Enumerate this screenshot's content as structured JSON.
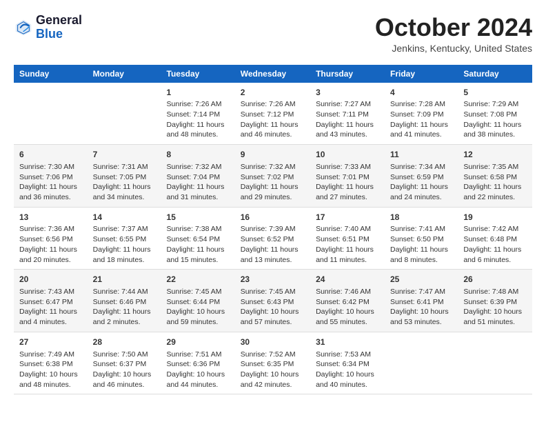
{
  "header": {
    "logo_line1": "General",
    "logo_line2": "Blue",
    "month": "October 2024",
    "location": "Jenkins, Kentucky, United States"
  },
  "days_of_week": [
    "Sunday",
    "Monday",
    "Tuesday",
    "Wednesday",
    "Thursday",
    "Friday",
    "Saturday"
  ],
  "weeks": [
    [
      {
        "day": "",
        "info": ""
      },
      {
        "day": "",
        "info": ""
      },
      {
        "day": "1",
        "info": "Sunrise: 7:26 AM\nSunset: 7:14 PM\nDaylight: 11 hours and 48 minutes."
      },
      {
        "day": "2",
        "info": "Sunrise: 7:26 AM\nSunset: 7:12 PM\nDaylight: 11 hours and 46 minutes."
      },
      {
        "day": "3",
        "info": "Sunrise: 7:27 AM\nSunset: 7:11 PM\nDaylight: 11 hours and 43 minutes."
      },
      {
        "day": "4",
        "info": "Sunrise: 7:28 AM\nSunset: 7:09 PM\nDaylight: 11 hours and 41 minutes."
      },
      {
        "day": "5",
        "info": "Sunrise: 7:29 AM\nSunset: 7:08 PM\nDaylight: 11 hours and 38 minutes."
      }
    ],
    [
      {
        "day": "6",
        "info": "Sunrise: 7:30 AM\nSunset: 7:06 PM\nDaylight: 11 hours and 36 minutes."
      },
      {
        "day": "7",
        "info": "Sunrise: 7:31 AM\nSunset: 7:05 PM\nDaylight: 11 hours and 34 minutes."
      },
      {
        "day": "8",
        "info": "Sunrise: 7:32 AM\nSunset: 7:04 PM\nDaylight: 11 hours and 31 minutes."
      },
      {
        "day": "9",
        "info": "Sunrise: 7:32 AM\nSunset: 7:02 PM\nDaylight: 11 hours and 29 minutes."
      },
      {
        "day": "10",
        "info": "Sunrise: 7:33 AM\nSunset: 7:01 PM\nDaylight: 11 hours and 27 minutes."
      },
      {
        "day": "11",
        "info": "Sunrise: 7:34 AM\nSunset: 6:59 PM\nDaylight: 11 hours and 24 minutes."
      },
      {
        "day": "12",
        "info": "Sunrise: 7:35 AM\nSunset: 6:58 PM\nDaylight: 11 hours and 22 minutes."
      }
    ],
    [
      {
        "day": "13",
        "info": "Sunrise: 7:36 AM\nSunset: 6:56 PM\nDaylight: 11 hours and 20 minutes."
      },
      {
        "day": "14",
        "info": "Sunrise: 7:37 AM\nSunset: 6:55 PM\nDaylight: 11 hours and 18 minutes."
      },
      {
        "day": "15",
        "info": "Sunrise: 7:38 AM\nSunset: 6:54 PM\nDaylight: 11 hours and 15 minutes."
      },
      {
        "day": "16",
        "info": "Sunrise: 7:39 AM\nSunset: 6:52 PM\nDaylight: 11 hours and 13 minutes."
      },
      {
        "day": "17",
        "info": "Sunrise: 7:40 AM\nSunset: 6:51 PM\nDaylight: 11 hours and 11 minutes."
      },
      {
        "day": "18",
        "info": "Sunrise: 7:41 AM\nSunset: 6:50 PM\nDaylight: 11 hours and 8 minutes."
      },
      {
        "day": "19",
        "info": "Sunrise: 7:42 AM\nSunset: 6:48 PM\nDaylight: 11 hours and 6 minutes."
      }
    ],
    [
      {
        "day": "20",
        "info": "Sunrise: 7:43 AM\nSunset: 6:47 PM\nDaylight: 11 hours and 4 minutes."
      },
      {
        "day": "21",
        "info": "Sunrise: 7:44 AM\nSunset: 6:46 PM\nDaylight: 11 hours and 2 minutes."
      },
      {
        "day": "22",
        "info": "Sunrise: 7:45 AM\nSunset: 6:44 PM\nDaylight: 10 hours and 59 minutes."
      },
      {
        "day": "23",
        "info": "Sunrise: 7:45 AM\nSunset: 6:43 PM\nDaylight: 10 hours and 57 minutes."
      },
      {
        "day": "24",
        "info": "Sunrise: 7:46 AM\nSunset: 6:42 PM\nDaylight: 10 hours and 55 minutes."
      },
      {
        "day": "25",
        "info": "Sunrise: 7:47 AM\nSunset: 6:41 PM\nDaylight: 10 hours and 53 minutes."
      },
      {
        "day": "26",
        "info": "Sunrise: 7:48 AM\nSunset: 6:39 PM\nDaylight: 10 hours and 51 minutes."
      }
    ],
    [
      {
        "day": "27",
        "info": "Sunrise: 7:49 AM\nSunset: 6:38 PM\nDaylight: 10 hours and 48 minutes."
      },
      {
        "day": "28",
        "info": "Sunrise: 7:50 AM\nSunset: 6:37 PM\nDaylight: 10 hours and 46 minutes."
      },
      {
        "day": "29",
        "info": "Sunrise: 7:51 AM\nSunset: 6:36 PM\nDaylight: 10 hours and 44 minutes."
      },
      {
        "day": "30",
        "info": "Sunrise: 7:52 AM\nSunset: 6:35 PM\nDaylight: 10 hours and 42 minutes."
      },
      {
        "day": "31",
        "info": "Sunrise: 7:53 AM\nSunset: 6:34 PM\nDaylight: 10 hours and 40 minutes."
      },
      {
        "day": "",
        "info": ""
      },
      {
        "day": "",
        "info": ""
      }
    ]
  ]
}
